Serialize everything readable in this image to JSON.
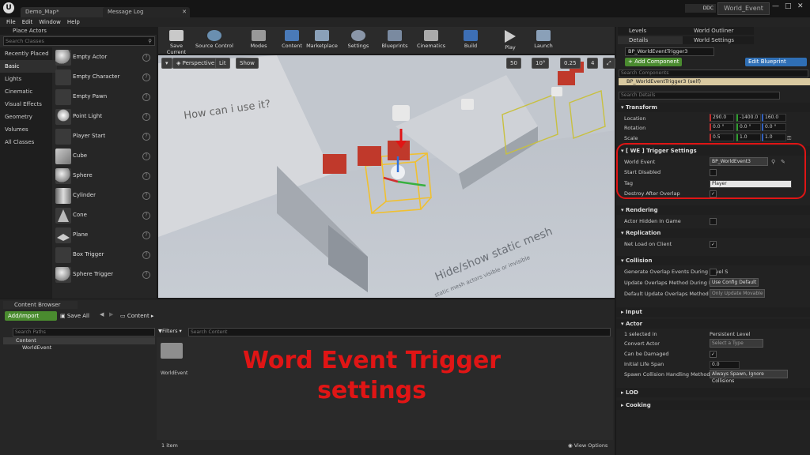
{
  "titlebar": {
    "tab1": "Demo_Map*",
    "tab2": "Message Log",
    "ddc": "DDC",
    "project": "World_Event"
  },
  "menu": [
    "File",
    "Edit",
    "Window",
    "Help"
  ],
  "place_actors": {
    "title": "Place Actors",
    "search_placeholder": "Search Classes",
    "categories": [
      "Recently Placed",
      "Basic",
      "Lights",
      "Cinematic",
      "Visual Effects",
      "Geometry",
      "Volumes",
      "All Classes"
    ],
    "actors": [
      "Empty Actor",
      "Empty Character",
      "Empty Pawn",
      "Point Light",
      "Player Start",
      "Cube",
      "Sphere",
      "Cylinder",
      "Cone",
      "Plane",
      "Box Trigger",
      "Sphere Trigger"
    ]
  },
  "toolbar": [
    "Save Current",
    "Source Control",
    "Modes",
    "Content",
    "Marketplace",
    "Settings",
    "Blueprints",
    "Cinematics",
    "Build",
    "Play",
    "Launch"
  ],
  "viewport": {
    "perspective": "Perspective",
    "lit": "Lit",
    "show": "Show",
    "grid": "50",
    "angle": "10°",
    "scale": "0.25",
    "cam": "4",
    "wall_text": "How can i use it?",
    "floor_text1": "Hide/show static mesh",
    "floor_text2": "static mesh actors visible or invisible"
  },
  "content_browser": {
    "tab": "Content Browser",
    "add": "Add/Import",
    "save_all": "Save All",
    "path": "Content",
    "search_paths": "Search Paths",
    "filters": "Filters",
    "search_content": "Search Content",
    "tree": [
      "Content",
      "WorldEvent"
    ],
    "folder": "WorldEvent",
    "count": "1 item",
    "view_options": "View Options"
  },
  "overlay": {
    "line1": "Word Event Trigger",
    "line2": "settings",
    "color": "#e01515"
  },
  "right_tabs": {
    "levels": "Levels",
    "world_outliner": "World Outliner",
    "details": "Details",
    "world_settings": "World Settings"
  },
  "details": {
    "name": "BP_WorldEventTrigger3",
    "add_component": "+ Add Component",
    "edit_blueprint": "Edit Blueprint",
    "search_components": "Search Components",
    "self_item": "BP_WorldEventTrigger3 (self)",
    "search_details": "Search Details",
    "transform": {
      "title": "Transform",
      "location_label": "Location",
      "rotation_label": "Rotation",
      "scale_label": "Scale",
      "location": [
        "290.0",
        "-1400.0",
        "160.0"
      ],
      "rotation": [
        "0.0 °",
        "0.0 °",
        "0.0 °"
      ],
      "scale": [
        "0.5",
        "1.0",
        "1.0"
      ]
    },
    "trigger": {
      "title": "[ WE ] Trigger Settings",
      "world_event_label": "World Event",
      "world_event_value": "BP_WorldEvent3",
      "start_disabled_label": "Start Disabled",
      "tag_label": "Tag",
      "tag_value": "Player",
      "destroy_label": "Destroy After Overlap"
    },
    "rendering": {
      "title": "Rendering",
      "hidden_label": "Actor Hidden In Game"
    },
    "replication": {
      "title": "Replication",
      "net_load_label": "Net Load on Client"
    },
    "collision": {
      "title": "Collision",
      "gen_label": "Generate Overlap Events During Level S",
      "update_label": "Update Overlaps Method During Level S",
      "update_value": "Use Config Default",
      "default_label": "Default Update Overlaps Method During",
      "default_value": "Only Update Movable"
    },
    "input": {
      "title": "Input"
    },
    "actor": {
      "title": "Actor",
      "selected": "1 selected in",
      "level": "Persistent Level",
      "convert_label": "Convert Actor",
      "convert_value": "Select a Type",
      "damage_label": "Can be Damaged",
      "life_label": "Initial Life Span",
      "life_value": "0.0",
      "spawn_label": "Spawn Collision Handling Method",
      "spawn_value": "Always Spawn, Ignore Collisions"
    },
    "lod": {
      "title": "LOD"
    },
    "cooking": {
      "title": "Cooking"
    }
  }
}
